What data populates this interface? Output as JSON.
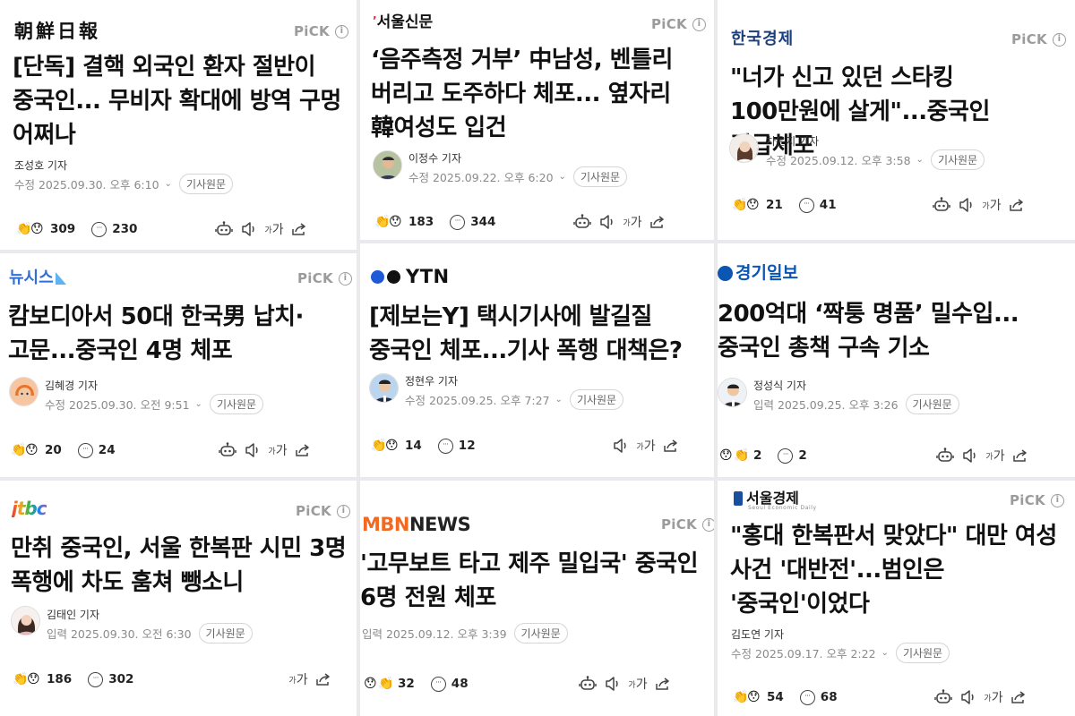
{
  "common": {
    "pick_label": "PiCK",
    "info_glyph": "i",
    "origin_label": "기사원문",
    "chevron": "⌄",
    "emoji_a": "👏",
    "emoji_b": "😯",
    "comment_glyph": "···",
    "font_small": "가",
    "font_large": "가"
  },
  "cards": [
    {
      "publisher": "朝鮮日報",
      "headline": "[단독] 결핵 외국인 환자 절반이 중국인... 무비자 확대에 방역 구멍 어쩌나",
      "reporter": "조성호 기자",
      "date": "수정 2025.09.30. 오후 6:10",
      "reactions": "309",
      "comments": "230"
    },
    {
      "publisher": "서울신문",
      "headline": "‘음주측정 거부’ 中남성, 벤틀리 버리고 도주하다 체포... 옆자리 韓여성도 입건",
      "reporter": "이정수 기자",
      "date": "수정 2025.09.22. 오후 6:20",
      "reactions": "183",
      "comments": "344"
    },
    {
      "publisher": "한국경제",
      "headline": "\"너가 신고 있던 스타킹 100만원에 살게\"...중국인 긴급체포",
      "reporter": "차은지 기자",
      "date": "수정 2025.09.12. 오후 3:58",
      "reactions": "21",
      "comments": "41"
    },
    {
      "publisher": "뉴시스",
      "headline": "캄보디아서 50대 한국男 납치·고문...중국인 4명 체포",
      "reporter": "김혜경 기자",
      "date": "수정 2025.09.30. 오전 9:51",
      "reactions": "20",
      "comments": "24"
    },
    {
      "publisher": "YTN",
      "headline": "[제보는Y] 택시기사에 발길질 중국인 체포...기사 폭행 대책은?",
      "reporter": "정현우 기자",
      "date": "수정 2025.09.25. 오후 7:27",
      "reactions": "14",
      "comments": "12"
    },
    {
      "publisher": "경기일보",
      "headline": "200억대 ‘짝퉁 명품’ 밀수입...중국인 총책 구속 기소",
      "reporter": "정성식 기자",
      "date": "입력 2025.09.25. 오후 3:26",
      "reactions": "2",
      "comments": "2"
    },
    {
      "publisher": "jtbc",
      "headline": "만취 중국인, 서울 한복판 시민 3명 폭행에 차도 훔쳐 뺑소니",
      "reporter": "김태인 기자",
      "date": "입력 2025.09.30. 오전 6:30",
      "reactions": "186",
      "comments": "302"
    },
    {
      "publisher_a": "MBN",
      "publisher_b": "NEWS",
      "headline": "'고무보트 타고 제주 밀입국' 중국인 6명 전원 체포",
      "date": "입력 2025.09.12. 오후 3:39",
      "reactions": "32",
      "comments": "48"
    },
    {
      "publisher": "서울경제",
      "publisher_sub": "Seoul Economic Daily",
      "headline": "\"홍대 한복판서 맞았다\" 대만 여성 사건 '대반전'...범인은 '중국인'이었다",
      "reporter": "김도연 기자",
      "date": "수정 2025.09.17. 오후 2:22",
      "reactions": "54",
      "comments": "68"
    }
  ],
  "colors": {
    "divider": "#e9e9ee",
    "newsis_blue": "#2f6fd6",
    "hankyung_navy": "#1c3f7a",
    "ytn_blue": "#1e5ad7",
    "kyeonggi_blue": "#0b55b3",
    "mbn_orange": "#f26a21",
    "seoul_econ_blue": "#1a4e9f"
  }
}
